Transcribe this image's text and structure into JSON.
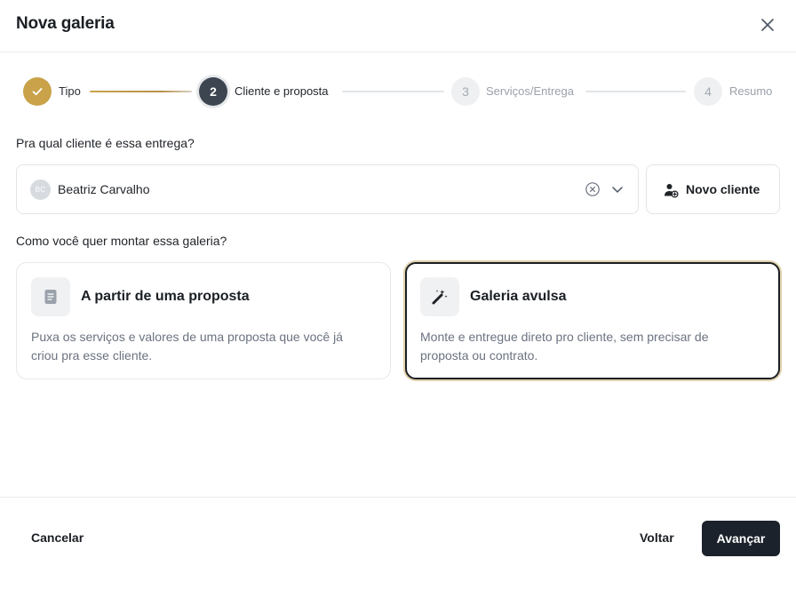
{
  "modal": {
    "title": "Nova galeria"
  },
  "stepper": {
    "steps": [
      {
        "number": "",
        "label": "Tipo",
        "state": "completed"
      },
      {
        "number": "2",
        "label": "Cliente e proposta",
        "state": "active"
      },
      {
        "number": "3",
        "label": "Serviços/Entrega",
        "state": "upcoming"
      },
      {
        "number": "4",
        "label": "Resumo",
        "state": "upcoming"
      }
    ]
  },
  "client": {
    "question": "Pra qual cliente é essa entrega?",
    "selected_initials": "BC",
    "selected_name": "Beatriz Carvalho",
    "new_client_label": "Novo cliente"
  },
  "mode": {
    "question": "Como você quer montar essa galeria?",
    "options": [
      {
        "title": "A partir de uma proposta",
        "description": "Puxa os serviços e valores de uma proposta que você já criou pra esse cliente.",
        "selected": false
      },
      {
        "title": "Galeria avulsa",
        "description": "Monte e entregue direto pro cliente, sem precisar de proposta ou contrato.",
        "selected": true
      }
    ]
  },
  "footer": {
    "cancel_label": "Cancelar",
    "back_label": "Voltar",
    "next_label": "Avançar"
  },
  "colors": {
    "accent_gold": "#c9a24a",
    "primary_dark": "#1b222b",
    "active_step": "#3d4650"
  },
  "icons": {
    "close": "close-icon",
    "completed_step": "check-icon",
    "clear": "clear-circle-icon",
    "dropdown": "chevron-down-icon",
    "new_client": "user-plus-icon",
    "proposal": "document-icon",
    "standalone": "magic-wand-icon"
  }
}
